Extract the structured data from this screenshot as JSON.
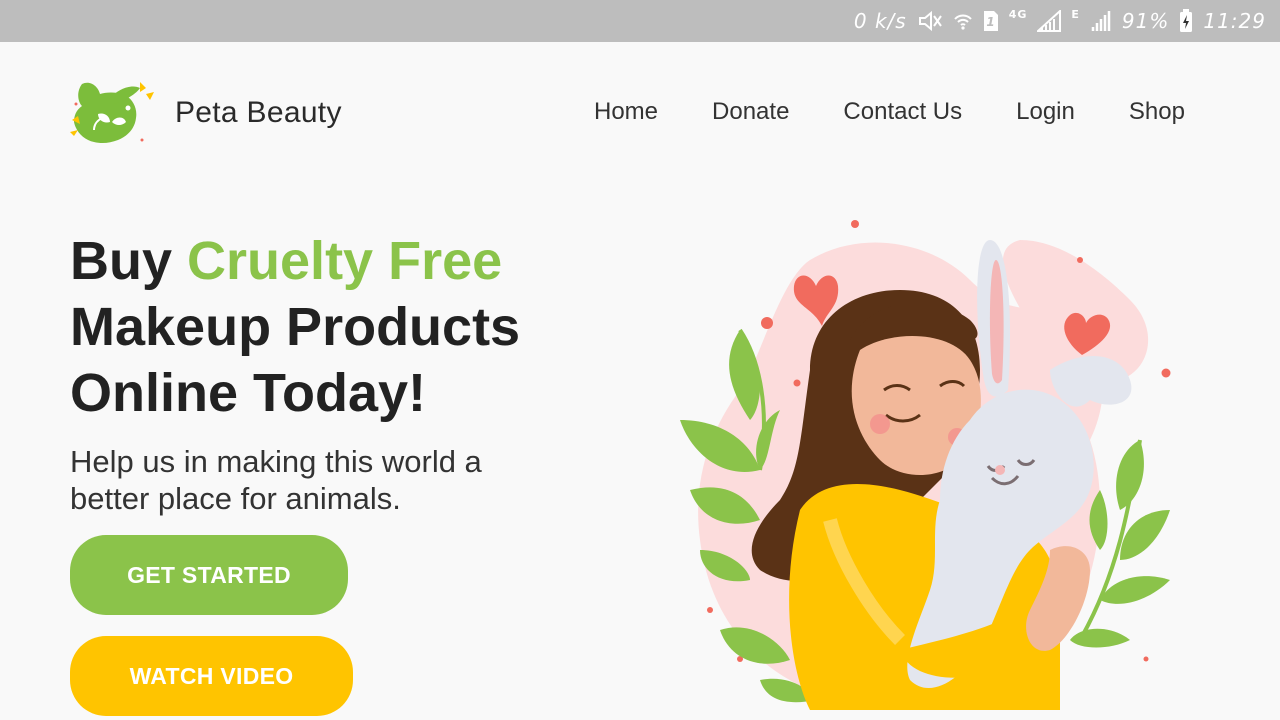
{
  "status_bar": {
    "net_speed": "0 k/s",
    "sim_number": "1",
    "network_4g": "4G",
    "network_e": "E",
    "battery": "91%",
    "time": "11:29"
  },
  "header": {
    "brand": "Peta Beauty",
    "nav": [
      {
        "label": "Home"
      },
      {
        "label": "Donate"
      },
      {
        "label": "Contact Us"
      },
      {
        "label": "Login"
      },
      {
        "label": "Shop"
      }
    ]
  },
  "hero": {
    "title_part1": "Buy ",
    "title_accent": "Cruelty Free",
    "title_part2": "Makeup Products Online Today!",
    "subtitle": "Help us in making this world a better place for animals.",
    "primary_button": "GET STARTED",
    "secondary_button": "WATCH VIDEO"
  },
  "colors": {
    "accent_green": "#8bc34a",
    "accent_yellow": "#ffc400",
    "status_bar": "#bdbdbd"
  },
  "icons": [
    "mute-icon",
    "wifi-icon",
    "sim-icon",
    "signal-icon",
    "battery-charging-icon",
    "bunny-logo-icon"
  ]
}
